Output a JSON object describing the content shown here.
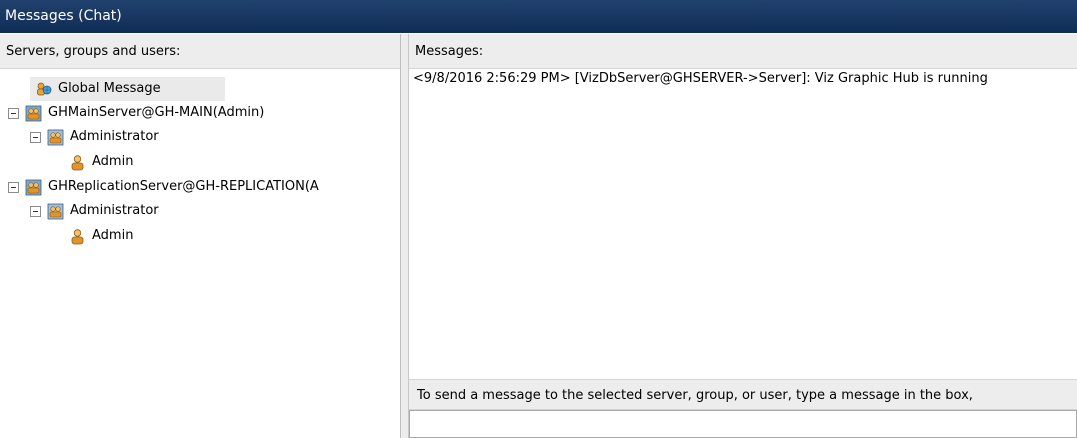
{
  "window": {
    "title": "Messages (Chat)"
  },
  "tree_panel": {
    "header": "Servers, groups and users:",
    "nodes": [
      {
        "label": "Global Message",
        "kind": "global",
        "expandable": false,
        "selected": true
      },
      {
        "label": "GHMainServer@GH-MAIN(Admin)",
        "kind": "server",
        "expandable": true
      },
      {
        "label": "Administrator",
        "kind": "group",
        "expandable": true
      },
      {
        "label": "Admin",
        "kind": "user",
        "expandable": false
      },
      {
        "label": "GHReplicationServer@GH-REPLICATION(A",
        "kind": "server",
        "expandable": true
      },
      {
        "label": "Administrator",
        "kind": "group",
        "expandable": true
      },
      {
        "label": "Admin",
        "kind": "user",
        "expandable": false
      }
    ]
  },
  "messages_panel": {
    "header": "Messages:",
    "lines": [
      "<9/8/2016 2:56:29 PM> [VizDbServer@GHSERVER->Server]: Viz Graphic Hub is running"
    ]
  },
  "compose": {
    "hint": "To send a message to the selected server, group, or user, type a message in the box,",
    "value": ""
  }
}
